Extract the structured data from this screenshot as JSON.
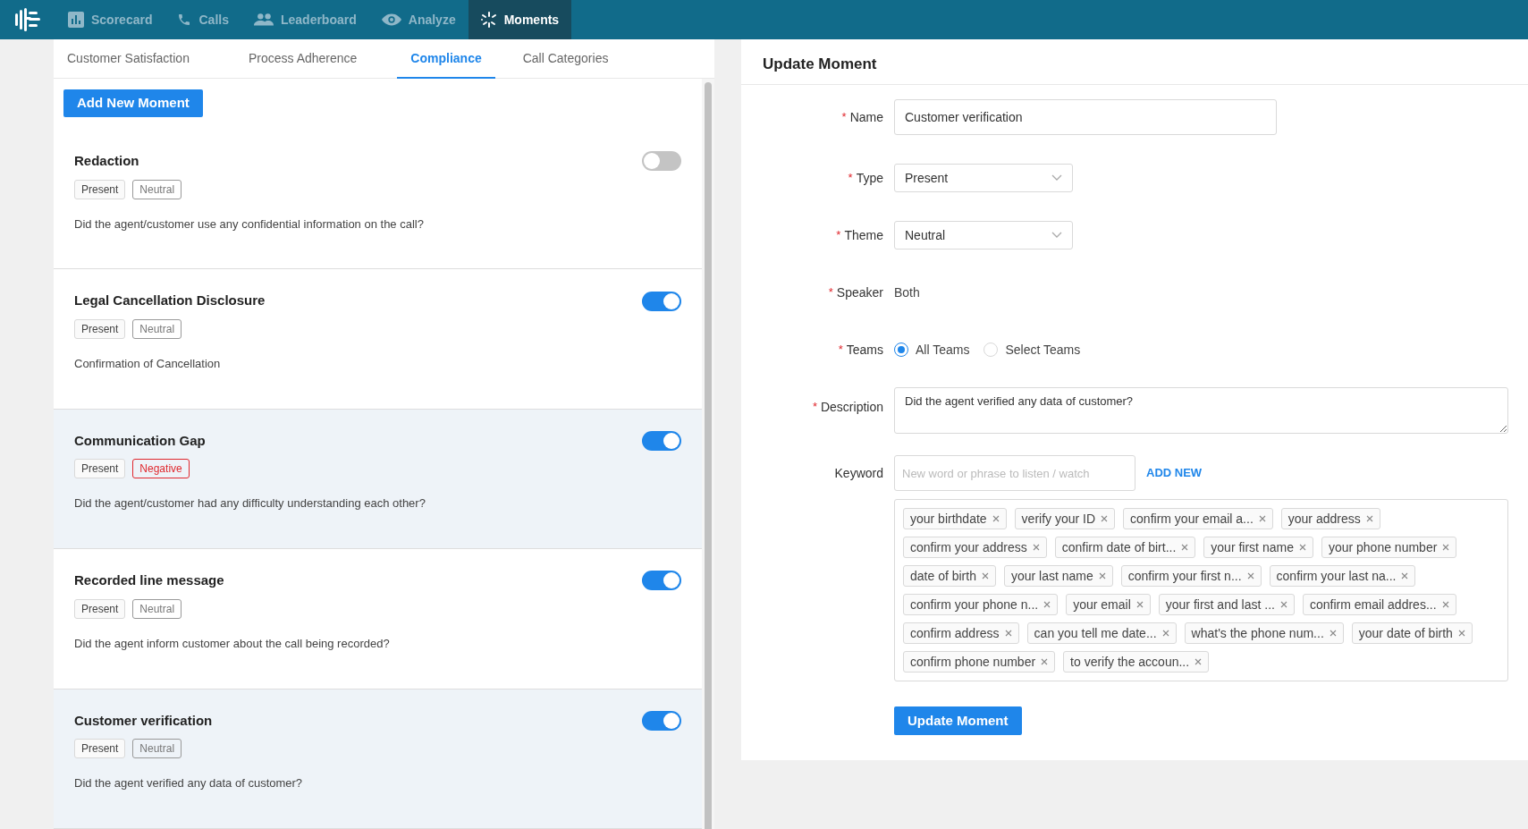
{
  "nav": [
    {
      "label": "Scorecard",
      "selected": false
    },
    {
      "label": "Calls",
      "selected": false
    },
    {
      "label": "Leaderboard",
      "selected": false
    },
    {
      "label": "Analyze",
      "selected": false
    },
    {
      "label": "Moments",
      "selected": true
    }
  ],
  "tabs": [
    {
      "label": "Customer Satisfaction",
      "selected": false
    },
    {
      "label": "Process Adherence",
      "selected": false
    },
    {
      "label": "Compliance",
      "selected": true
    },
    {
      "label": "Call Categories",
      "selected": false
    }
  ],
  "add_button": "Add New Moment",
  "moments": [
    {
      "title": "Redaction",
      "type": "Present",
      "theme": "Neutral",
      "theme_negative": false,
      "description": "Did the agent/customer use any confidential information on the call?",
      "on": false,
      "highlighted": false
    },
    {
      "title": "Legal Cancellation Disclosure",
      "type": "Present",
      "theme": "Neutral",
      "theme_negative": false,
      "description": "Confirmation of Cancellation",
      "on": true,
      "highlighted": false
    },
    {
      "title": "Communication Gap",
      "type": "Present",
      "theme": "Negative",
      "theme_negative": true,
      "description": "Did the agent/customer had any difficulty understanding each other?",
      "on": true,
      "highlighted": true
    },
    {
      "title": "Recorded line message",
      "type": "Present",
      "theme": "Neutral",
      "theme_negative": false,
      "description": "Did the agent inform customer about the call being recorded?",
      "on": true,
      "highlighted": false
    },
    {
      "title": "Customer verification",
      "type": "Present",
      "theme": "Neutral",
      "theme_negative": false,
      "description": "Did the agent verified any data of customer?",
      "on": true,
      "highlighted": true
    }
  ],
  "form": {
    "title": "Update Moment",
    "fields": [
      {
        "kind": "text",
        "label": "Name",
        "required_mark": "*",
        "value": "Customer verification"
      },
      {
        "kind": "select",
        "label": "Type",
        "required_mark": "*",
        "value": "Present"
      },
      {
        "kind": "select",
        "label": "Theme",
        "required_mark": "*",
        "value": "Neutral"
      },
      {
        "kind": "static",
        "label": "Speaker",
        "required_mark": "*",
        "value": "Both"
      },
      {
        "kind": "radio",
        "label": "Teams",
        "required_mark": "*",
        "options": [
          {
            "label": "All Teams",
            "selected": true
          },
          {
            "label": "Select Teams",
            "selected": false
          }
        ]
      },
      {
        "kind": "textarea",
        "label": "Description",
        "required_mark": "*",
        "value": "Did the agent verified any data of customer?"
      }
    ],
    "keyword": {
      "label": "Keyword",
      "placeholder": "New word or phrase to listen / watch",
      "add_label": "ADD NEW"
    },
    "keywords": [
      "your birthdate",
      "verify your ID",
      "confirm your email a...",
      "your address",
      "confirm your address",
      "confirm date of birt...",
      "your first name",
      "your phone number",
      "date of birth",
      "your last name",
      "confirm your first n...",
      "confirm your last na...",
      "confirm your phone n...",
      "your email",
      "your first and last ...",
      "confirm email addres...",
      "confirm address",
      "can you tell me date...",
      "what's the phone num...",
      "your date of birth",
      "confirm phone number",
      "to verify the accoun..."
    ],
    "submit": "Update Moment"
  }
}
